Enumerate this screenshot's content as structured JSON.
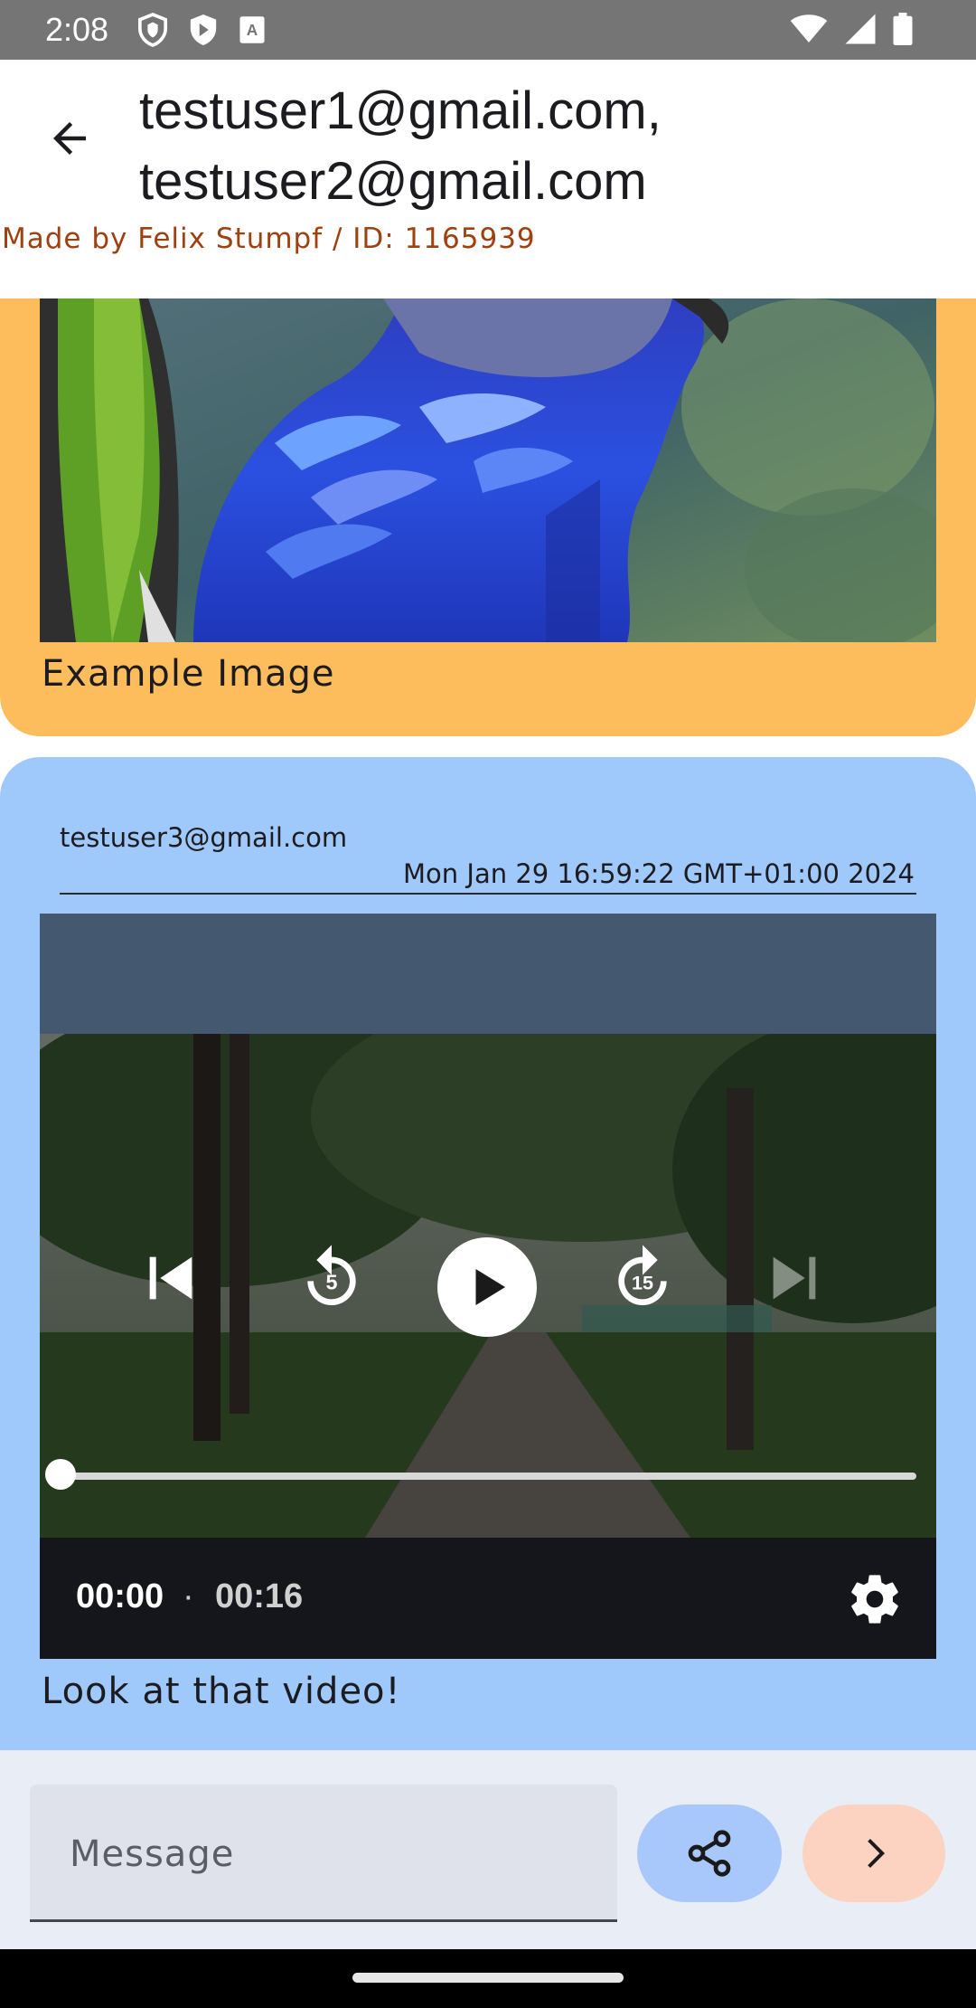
{
  "status_bar": {
    "time": "2:08",
    "left_icons": [
      "shield-icon",
      "shield-filled-icon",
      "keyboard-a-icon"
    ],
    "right_icons": [
      "wifi-icon",
      "signal-icon",
      "battery-icon"
    ]
  },
  "header": {
    "back_icon": "arrow-left-icon",
    "title": "testuser1@gmail.com, testuser2@gmail.com",
    "credit": "Made by Felix Stumpf / ID: 1165939"
  },
  "messages": [
    {
      "type": "image",
      "caption": "Example Image",
      "bubble_color": "#fdbd5c"
    },
    {
      "type": "video",
      "sender": "testuser3@gmail.com",
      "timestamp": "Mon Jan 29 16:59:22 GMT+01:00 2024",
      "caption": "Look at that video!",
      "bubble_color": "#9fc8fb",
      "player": {
        "time_current": "00:00",
        "separator": "·",
        "time_total": "00:16",
        "progress": 0,
        "controls": [
          "skip-previous-icon",
          "replay-5-icon",
          "play-icon",
          "forward-15-icon",
          "skip-next-icon",
          "settings-icon"
        ],
        "replay_seconds": "5",
        "forward_seconds": "15"
      }
    }
  ],
  "composer": {
    "placeholder": "Message",
    "share_icon": "share-icon",
    "send_icon": "chevron-right-icon"
  }
}
